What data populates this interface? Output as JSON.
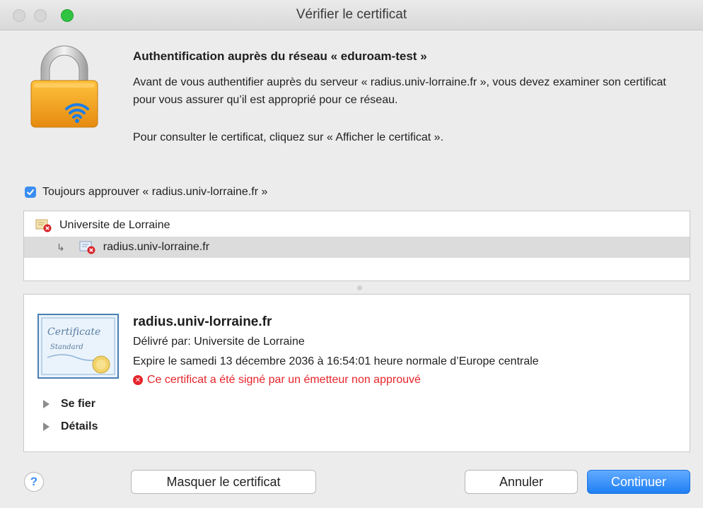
{
  "window": {
    "title": "Vérifier le certificat"
  },
  "header": {
    "heading": "Authentification auprès du réseau « eduroam-test »",
    "paragraph1": "Avant de vous authentifier auprès du serveur « radius.univ-lorraine.fr », vous devez examiner son certificat pour vous assurer qu’il est approprié pour ce réseau.",
    "paragraph2": "Pour consulter le certificat, cliquez sur « Afficher le certificat »."
  },
  "always_trust": {
    "checked": true,
    "label": "Toujours approuver « radius.univ-lorraine.fr »"
  },
  "chain": [
    {
      "label": "Universite de Lorraine",
      "selected": false
    },
    {
      "label": "radius.univ-lorraine.fr",
      "selected": true
    }
  ],
  "certificate": {
    "name": "radius.univ-lorraine.fr",
    "issuer": "Délivré par: Universite de Lorraine",
    "expires": "Expire le samedi 13 décembre 2036 à 16:54:01 heure normale d’Europe centrale",
    "warning": "Ce certificat a été signé par un émetteur non approuvé",
    "image_text_1": "Certificate",
    "image_text_2": "Standard"
  },
  "disclosures": {
    "trust_label": "Se fier",
    "details_label": "Détails"
  },
  "buttons": {
    "help": "?",
    "hide_certificate": "Masquer le certificat",
    "cancel": "Annuler",
    "continue": "Continuer"
  },
  "colors": {
    "accent": "#3b8ef0",
    "warning": "#e5242a",
    "lock_body": "#f0a020",
    "zoom_light": "#2fc441"
  },
  "icons": {
    "lock": "padlock-wifi-icon",
    "checkbox": "checkmark-icon",
    "chain_item": "certificate-error-icon",
    "child_arrow": "child-arrow-icon",
    "warning": "error-icon",
    "disclosure": "disclosure-triangle-icon"
  }
}
